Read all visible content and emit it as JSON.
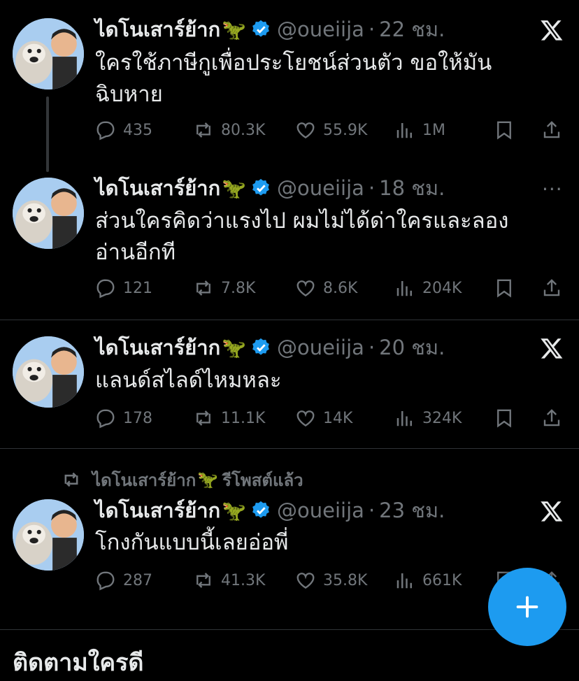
{
  "tweets": [
    {
      "name": "ไดโนเสาร์ย้าก",
      "emoji": "🦖",
      "handle": "@oueiija",
      "separator": "·",
      "time": "22 ชม.",
      "text": "ใครใช้ภาษีกูเพื่อประโยชน์ส่วนตัว ขอให้มันฉิบหาย",
      "replies": "435",
      "reposts": "80.3K",
      "likes": "55.9K",
      "views": "1M",
      "menu": "x-logo"
    },
    {
      "name": "ไดโนเสาร์ย้าก",
      "emoji": "🦖",
      "handle": "@oueiija",
      "separator": "·",
      "time": "18 ชม.",
      "text": "ส่วนใครคิดว่าแรงไป ผมไม่ได้ด่าใครและลองอ่านอีกที",
      "replies": "121",
      "reposts": "7.8K",
      "likes": "8.6K",
      "views": "204K",
      "menu": "more",
      "menu_text": "···"
    },
    {
      "name": "ไดโนเสาร์ย้าก",
      "emoji": "🦖",
      "handle": "@oueiija",
      "separator": "·",
      "time": "20 ชม.",
      "text": "แลนด์สไลด์ไหมหละ",
      "replies": "178",
      "reposts": "11.1K",
      "likes": "14K",
      "views": "324K",
      "menu": "x-logo"
    },
    {
      "name": "ไดโนเสาร์ย้าก",
      "emoji": "🦖",
      "handle": "@oueiija",
      "separator": "·",
      "time": "23 ชม.",
      "text": "โกงกันแบบนี้เลยอ่อพี่",
      "replies": "287",
      "reposts": "41.3K",
      "likes": "35.8K",
      "views": "661K",
      "menu": "x-logo"
    }
  ],
  "repost_banner": {
    "name": "ไดโนเสาร์ย้าก",
    "emoji": "🦖",
    "label": "รีโพสต์แล้ว"
  },
  "bottom_text": "ติดตามใครดี",
  "colors": {
    "background": "#000000",
    "text": "#e7e9ea",
    "muted": "#71767b",
    "accent": "#1d9bf0",
    "divider": "#2f3336"
  },
  "icons": [
    "reply-icon",
    "repost-icon",
    "like-icon",
    "views-icon",
    "bookmark-icon",
    "share-icon",
    "verified-icon",
    "x-logo-icon",
    "compose-plus-icon"
  ]
}
